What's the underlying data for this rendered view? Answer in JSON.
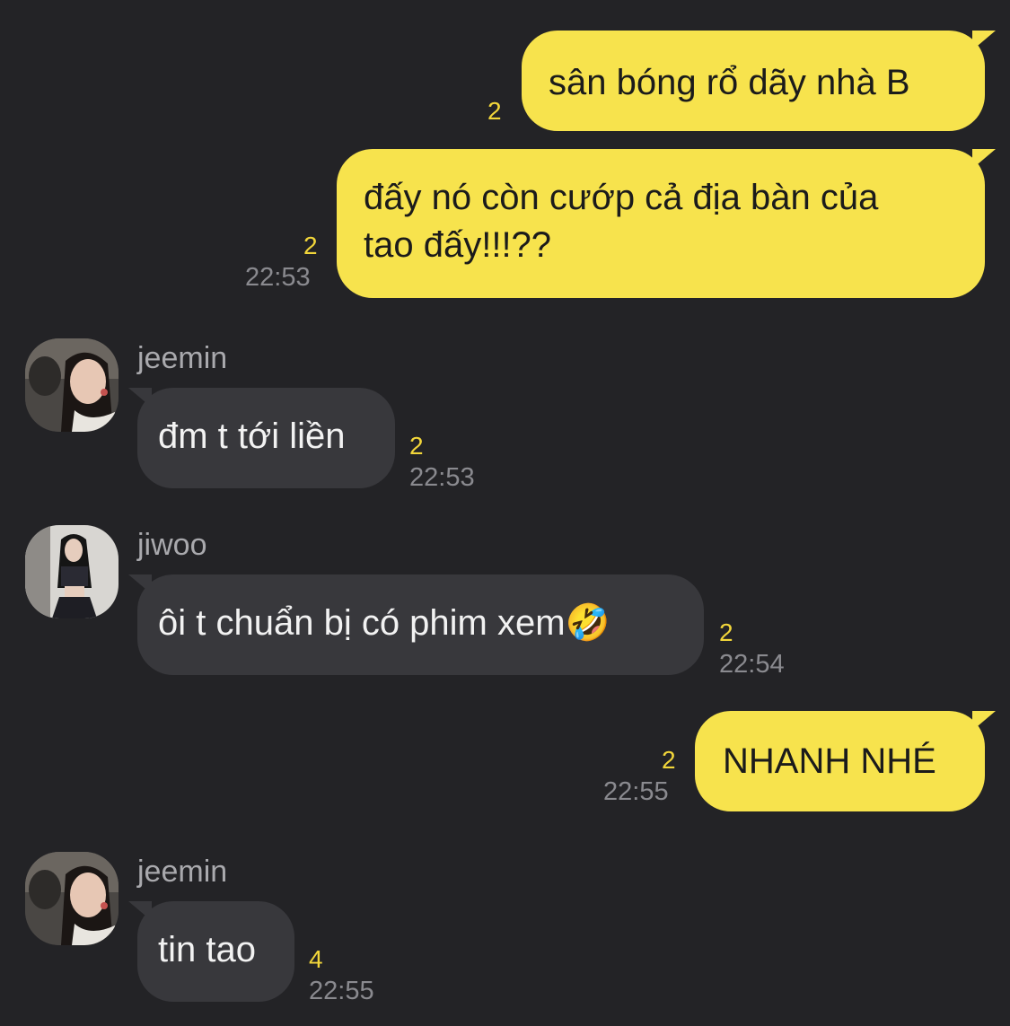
{
  "messages": [
    {
      "text": "sân bóng rổ dãy nhà B",
      "unread": "2",
      "time": ""
    },
    {
      "text": "đấy nó còn cướp cả địa bàn của\ntao đấy!!!??",
      "unread": "2",
      "time": "22:53"
    },
    {
      "sender": "jeemin",
      "text": "đm t tới liền",
      "unread": "2",
      "time": "22:53",
      "avatar_icon": "jeemin-avatar"
    },
    {
      "sender": "jiwoo",
      "text": "ôi t chuẩn bị có phim xem🤣",
      "unread": "2",
      "time": "22:54",
      "avatar_icon": "jiwoo-avatar"
    },
    {
      "text": "NHANH NHÉ",
      "unread": "2",
      "time": "22:55"
    },
    {
      "sender": "jeemin",
      "text": "tin tao",
      "unread": "4",
      "time": "22:55",
      "avatar_icon": "jeemin-avatar"
    }
  ],
  "colors": {
    "background": "#232326",
    "my_bubble": "#f7e34d",
    "their_bubble": "#38383c",
    "unread": "#f2d63a"
  }
}
